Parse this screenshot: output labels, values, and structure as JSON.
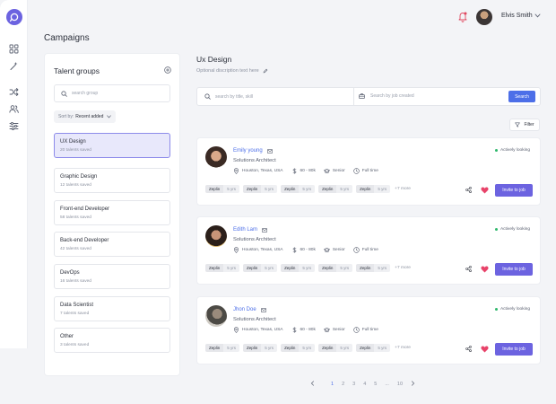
{
  "header": {
    "user_name": "Elvis Smith",
    "page_title": "Campaigns"
  },
  "sidebar": {
    "icons": [
      "grid-icon",
      "magic-wand-icon",
      "shuffle-icon",
      "users-icon",
      "sliders-icon"
    ]
  },
  "groups": {
    "title": "Talent groups",
    "search_placeholder": "search group",
    "sort_prefix": "Sort by:",
    "sort_value": "Recent added",
    "items": [
      {
        "name": "UX Design",
        "count": "20 talents saved",
        "active": true
      },
      {
        "name": "Graphic Design",
        "count": "12 talents saved",
        "active": false
      },
      {
        "name": "Front-end Developer",
        "count": "58 talents saved",
        "active": false
      },
      {
        "name": "Back-end Developer",
        "count": "42 talents saved",
        "active": false
      },
      {
        "name": "DevOps",
        "count": "16 talents saved",
        "active": false
      },
      {
        "name": "Data Scientist",
        "count": "7 talents saved",
        "active": false
      },
      {
        "name": "Other",
        "count": "3 talents saved",
        "active": false
      }
    ]
  },
  "main": {
    "job_title": "Ux Design",
    "job_description": "Optional discription text here",
    "search_placeholder": "search by title, skill",
    "job_placeholder": "Search by job created",
    "search_label": "Search",
    "filter_label": "Filter"
  },
  "candidates": [
    {
      "name": "Emily young",
      "role": "Solutions Architect",
      "location": "Houston, Texas, USA",
      "salary": "60 - 80k",
      "level": "Senior",
      "employment": "Full time",
      "status": "Actively looking",
      "skills": [
        {
          "name": "Zeplin",
          "years": "5 yrs"
        },
        {
          "name": "Zeplin",
          "years": "5 yrs"
        },
        {
          "name": "Zeplin",
          "years": "5 yrs"
        },
        {
          "name": "Zeplin",
          "years": "5 yrs"
        },
        {
          "name": "Zeplin",
          "years": "5 yrs"
        }
      ],
      "more": "+7 more",
      "invite_label": "Invite to job"
    },
    {
      "name": "Edith Lam",
      "role": "Solutions Architect",
      "location": "Houston, Texas, USA",
      "salary": "60 - 80k",
      "level": "Senior",
      "employment": "Full time",
      "status": "Actively looking",
      "skills": [
        {
          "name": "Zeplin",
          "years": "5 yrs"
        },
        {
          "name": "Zeplin",
          "years": "5 yrs"
        },
        {
          "name": "Zeplin",
          "years": "5 yrs"
        },
        {
          "name": "Zeplin",
          "years": "5 yrs"
        },
        {
          "name": "Zeplin",
          "years": "5 yrs"
        }
      ],
      "more": "+7 more",
      "invite_label": "Invite to job"
    },
    {
      "name": "Jhon Doe",
      "role": "Solutions Architect",
      "location": "Houston, Texas, USA",
      "salary": "60 - 80k",
      "level": "Senior",
      "employment": "Full time",
      "status": "Actively looking",
      "skills": [
        {
          "name": "Zeplin",
          "years": "5 yrs"
        },
        {
          "name": "Zeplin",
          "years": "5 yrs"
        },
        {
          "name": "Zeplin",
          "years": "5 yrs"
        },
        {
          "name": "Zeplin",
          "years": "5 yrs"
        },
        {
          "name": "Zeplin",
          "years": "5 yrs"
        }
      ],
      "more": "+7 more",
      "invite_label": "Invite to job"
    }
  ],
  "pagination": {
    "pages": [
      "1",
      "2",
      "3",
      "4",
      "5",
      "...",
      "10"
    ],
    "current": "1"
  },
  "colors": {
    "accent": "#6c63e0",
    "primary": "#4d6fe8",
    "active_green": "#2fb86b",
    "heart": "#e8436a"
  }
}
